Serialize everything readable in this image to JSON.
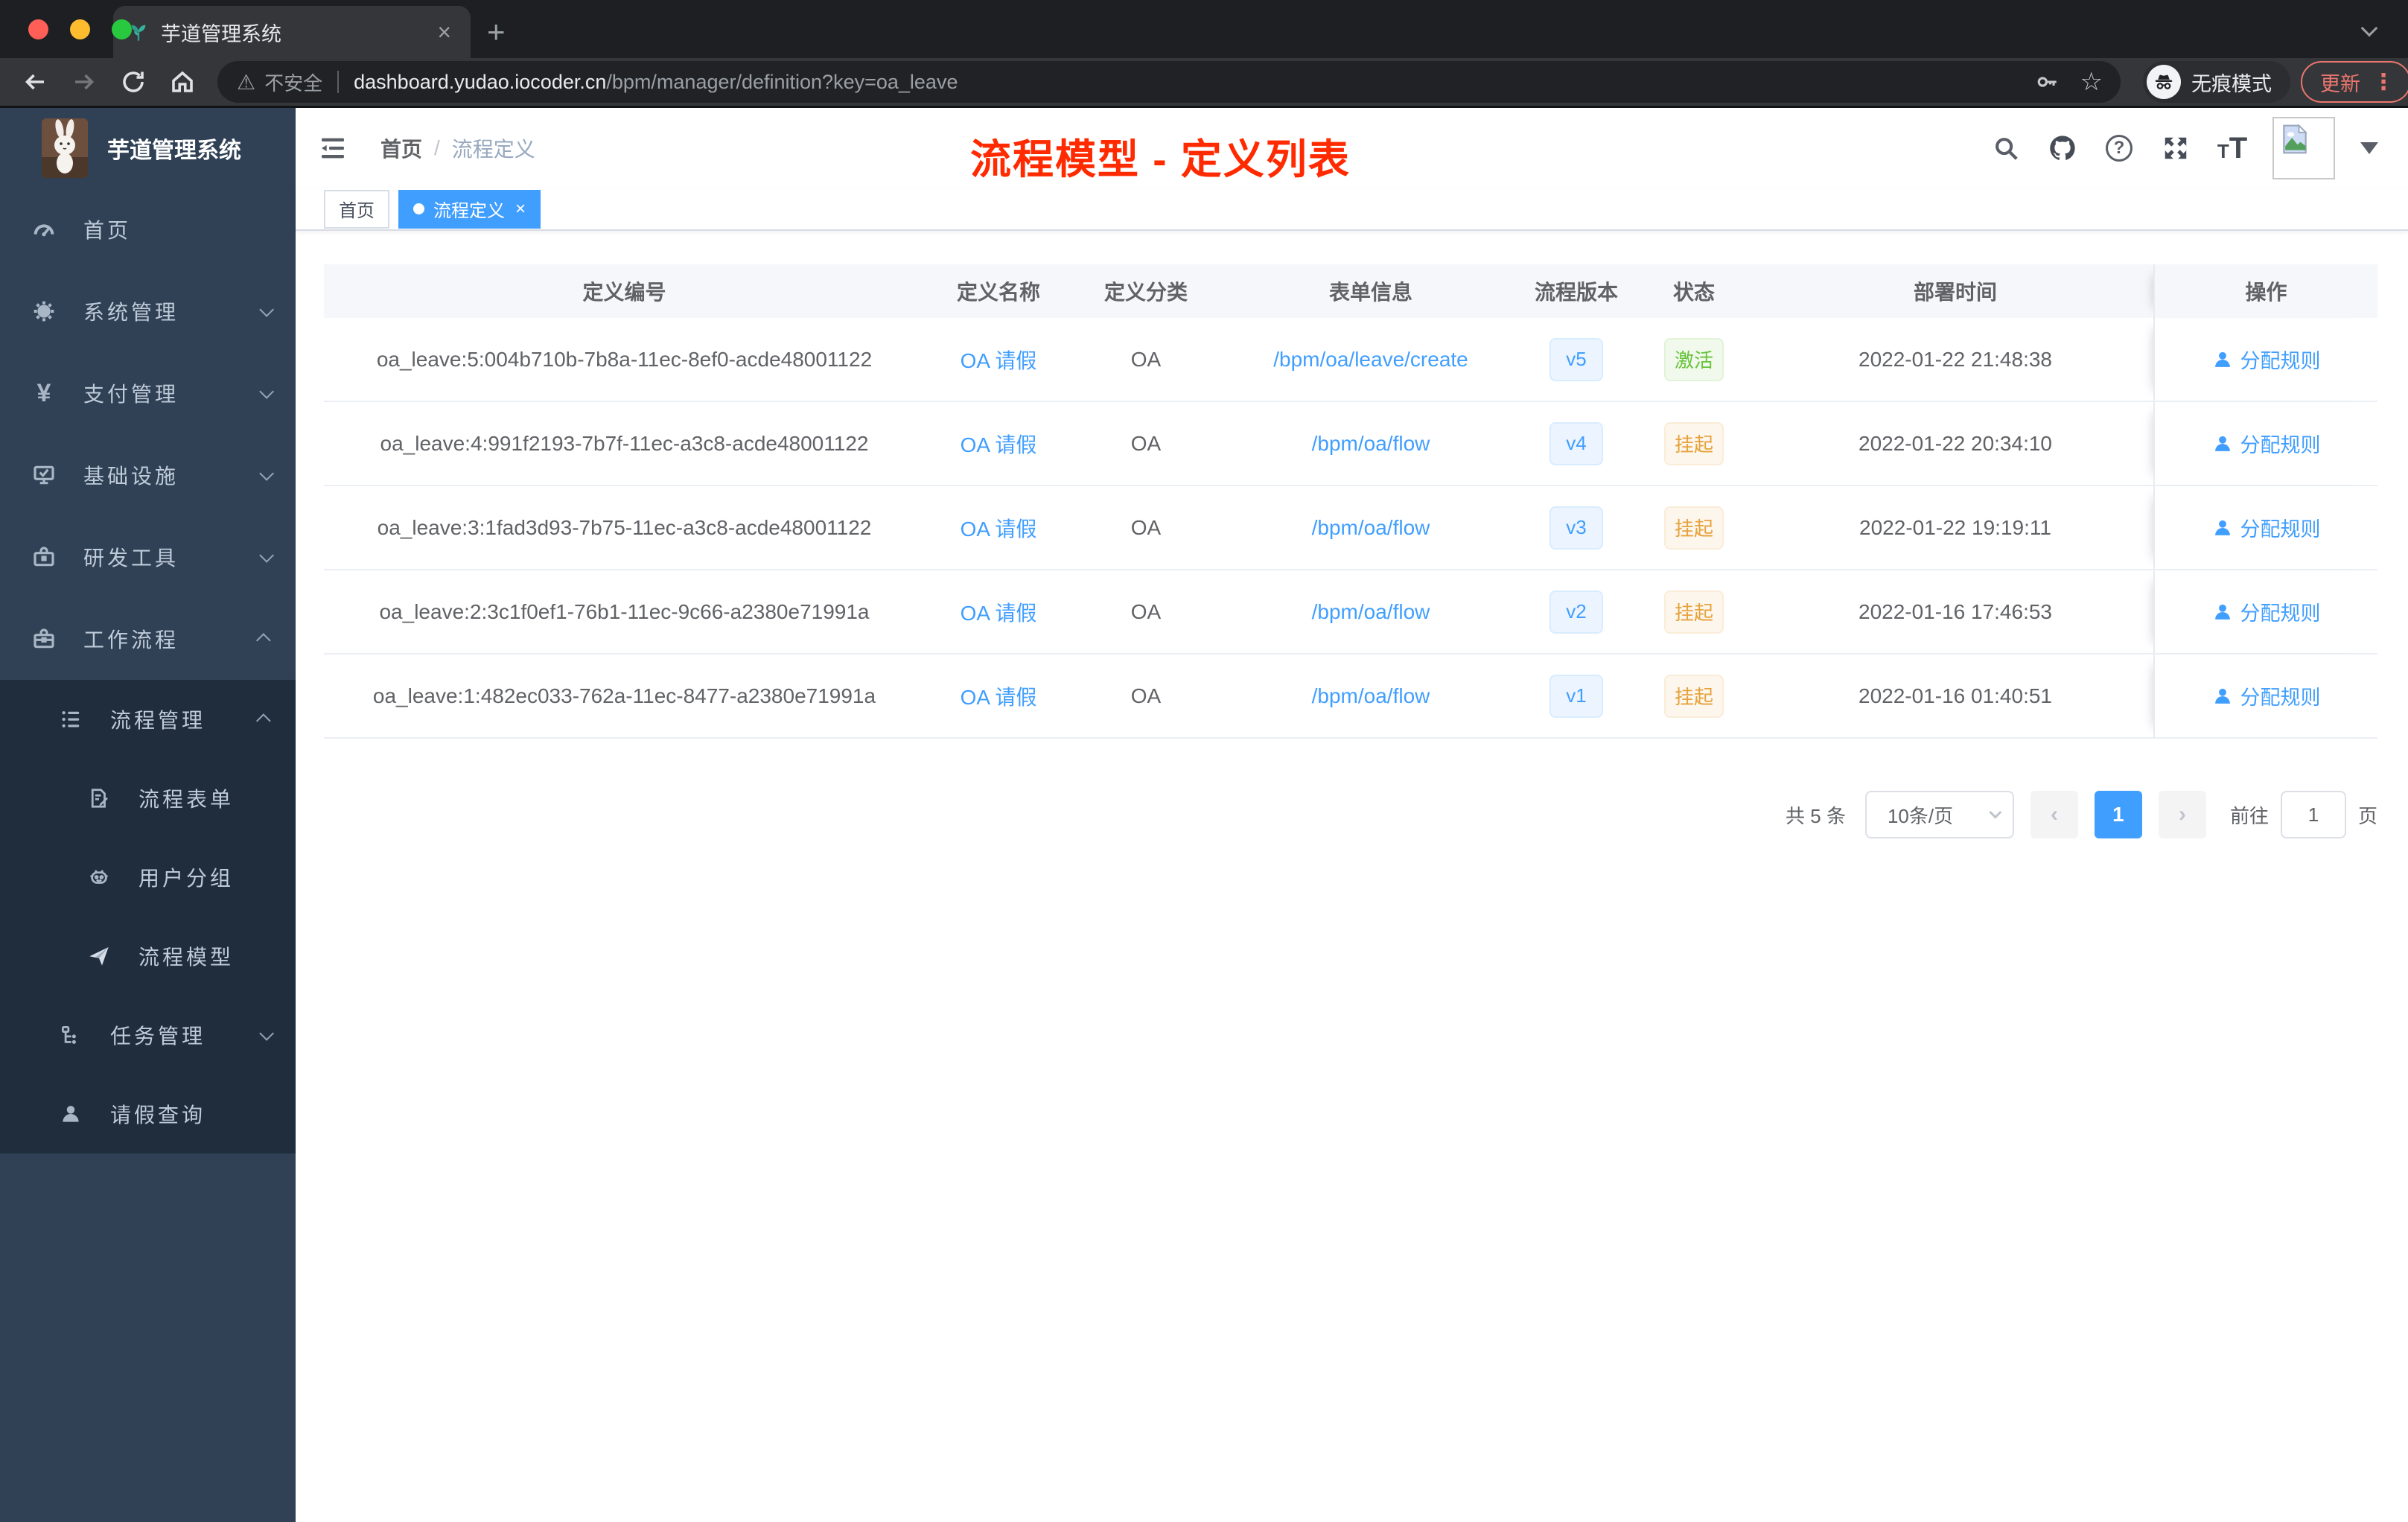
{
  "browser": {
    "tab_title": "芋道管理系统",
    "security_label": "不安全",
    "url_host": "dashboard.yudao.iocoder.cn",
    "url_path": "/bpm/manager/definition?key=oa_leave",
    "incognito_label": "无痕模式",
    "update_label": "更新"
  },
  "icons": {
    "close": "×",
    "plus": "+",
    "warning": "⚠",
    "star": "☆",
    "dots": "⋮",
    "question": "?",
    "font_large": "T",
    "font_small": "T",
    "yen": "¥",
    "chevron_left": "‹",
    "chevron_right": "›"
  },
  "header": {
    "breadcrumb_home": "首页",
    "breadcrumb_separator": "/",
    "breadcrumb_current": "流程定义",
    "annotation": "流程模型 - 定义列表"
  },
  "tags": {
    "home": "首页",
    "current": "流程定义"
  },
  "sidebar": {
    "logo_title": "芋道管理系统",
    "items": [
      {
        "label": "首页"
      },
      {
        "label": "系统管理"
      },
      {
        "label": "支付管理"
      },
      {
        "label": "基础设施"
      },
      {
        "label": "研发工具"
      },
      {
        "label": "工作流程"
      }
    ],
    "sub": [
      {
        "label": "流程管理"
      },
      {
        "label": "流程表单"
      },
      {
        "label": "用户分组"
      },
      {
        "label": "流程模型"
      },
      {
        "label": "任务管理"
      },
      {
        "label": "请假查询"
      }
    ]
  },
  "table": {
    "columns": [
      "定义编号",
      "定义名称",
      "定义分类",
      "表单信息",
      "流程版本",
      "状态",
      "部署时间",
      "操作"
    ],
    "rows": [
      {
        "id": "oa_leave:5:004b710b-7b8a-11ec-8ef0-acde48001122",
        "name": "OA 请假",
        "category": "OA",
        "form": "/bpm/oa/leave/create",
        "version": "v5",
        "status": "激活",
        "status_type": "active",
        "time": "2022-01-22 21:48:38",
        "action": "分配规则"
      },
      {
        "id": "oa_leave:4:991f2193-7b7f-11ec-a3c8-acde48001122",
        "name": "OA 请假",
        "category": "OA",
        "form": "/bpm/oa/flow",
        "version": "v4",
        "status": "挂起",
        "status_type": "suspended",
        "time": "2022-01-22 20:34:10",
        "action": "分配规则"
      },
      {
        "id": "oa_leave:3:1fad3d93-7b75-11ec-a3c8-acde48001122",
        "name": "OA 请假",
        "category": "OA",
        "form": "/bpm/oa/flow",
        "version": "v3",
        "status": "挂起",
        "status_type": "suspended",
        "time": "2022-01-22 19:19:11",
        "action": "分配规则"
      },
      {
        "id": "oa_leave:2:3c1f0ef1-76b1-11ec-9c66-a2380e71991a",
        "name": "OA 请假",
        "category": "OA",
        "form": "/bpm/oa/flow",
        "version": "v2",
        "status": "挂起",
        "status_type": "suspended",
        "time": "2022-01-16 17:46:53",
        "action": "分配规则"
      },
      {
        "id": "oa_leave:1:482ec033-762a-11ec-8477-a2380e71991a",
        "name": "OA 请假",
        "category": "OA",
        "form": "/bpm/oa/flow",
        "version": "v1",
        "status": "挂起",
        "status_type": "suspended",
        "time": "2022-01-16 01:40:51",
        "action": "分配规则"
      }
    ]
  },
  "pagination": {
    "total": "共 5 条",
    "page_size": "10条/页",
    "current_page": "1",
    "goto_label": "前往",
    "goto_value": "1",
    "unit": "页"
  },
  "colors": {
    "accent": "#409eff",
    "sidebar_bg": "#304156",
    "submenu_bg": "#1f2d3d",
    "annotation_red": "#ff2a00",
    "status_active": "#67c23a",
    "status_suspended": "#e6a23c"
  }
}
